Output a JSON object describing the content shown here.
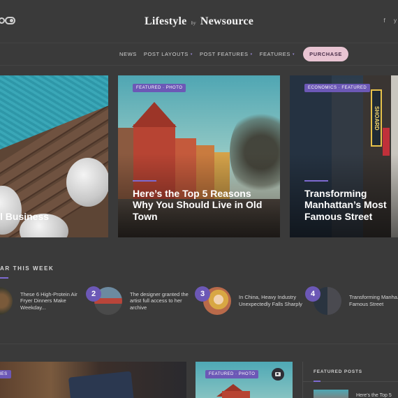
{
  "header": {
    "logo_main": "Lifestyle",
    "logo_by": "by",
    "logo_brand": "Newsource",
    "social": [
      "f",
      "y"
    ]
  },
  "nav": {
    "items": [
      {
        "label": "NEWS",
        "has_caret": false
      },
      {
        "label": "POST LAYOUTS",
        "has_caret": true
      },
      {
        "label": "POST FEATURES",
        "has_caret": true
      },
      {
        "label": "FEATURES",
        "has_caret": true
      }
    ],
    "caret": "▾",
    "purchase_label": "PURCHASE"
  },
  "hero": [
    {
      "badge": "",
      "title": "l Business"
    },
    {
      "badge": "FEATURED · PHOTO",
      "title": "Here’s the Top 5 Reasons Why You Should Live in Old Town"
    },
    {
      "badge": "ECONOMICS · FEATURED",
      "title": "Transforming Manhattan’s Most Famous Street",
      "sign": "SHOARD"
    }
  ],
  "popular": {
    "heading": "AR THIS WEEK",
    "items": [
      {
        "num": "",
        "text": "These 6 High-Protein Air Fryer Dinners Make Weekday..."
      },
      {
        "num": "2",
        "text": "The designer granted the artist full access to her archive"
      },
      {
        "num": "3",
        "text": "In China, Heavy Industry Unexpectedly Falls Sharply"
      },
      {
        "num": "4",
        "text": "Transforming Manha... Most Famous Street"
      }
    ]
  },
  "bottom": {
    "card1_badge": "VIES",
    "card2_badge": "FEATURED · PHOTO",
    "featured_title": "FEATURED POSTS",
    "featured_item": "Here’s the Top 5"
  },
  "colors": {
    "background": "#3a3a3a",
    "accent": "#6c58b6",
    "purchase_bg": "#e8c4d2"
  }
}
